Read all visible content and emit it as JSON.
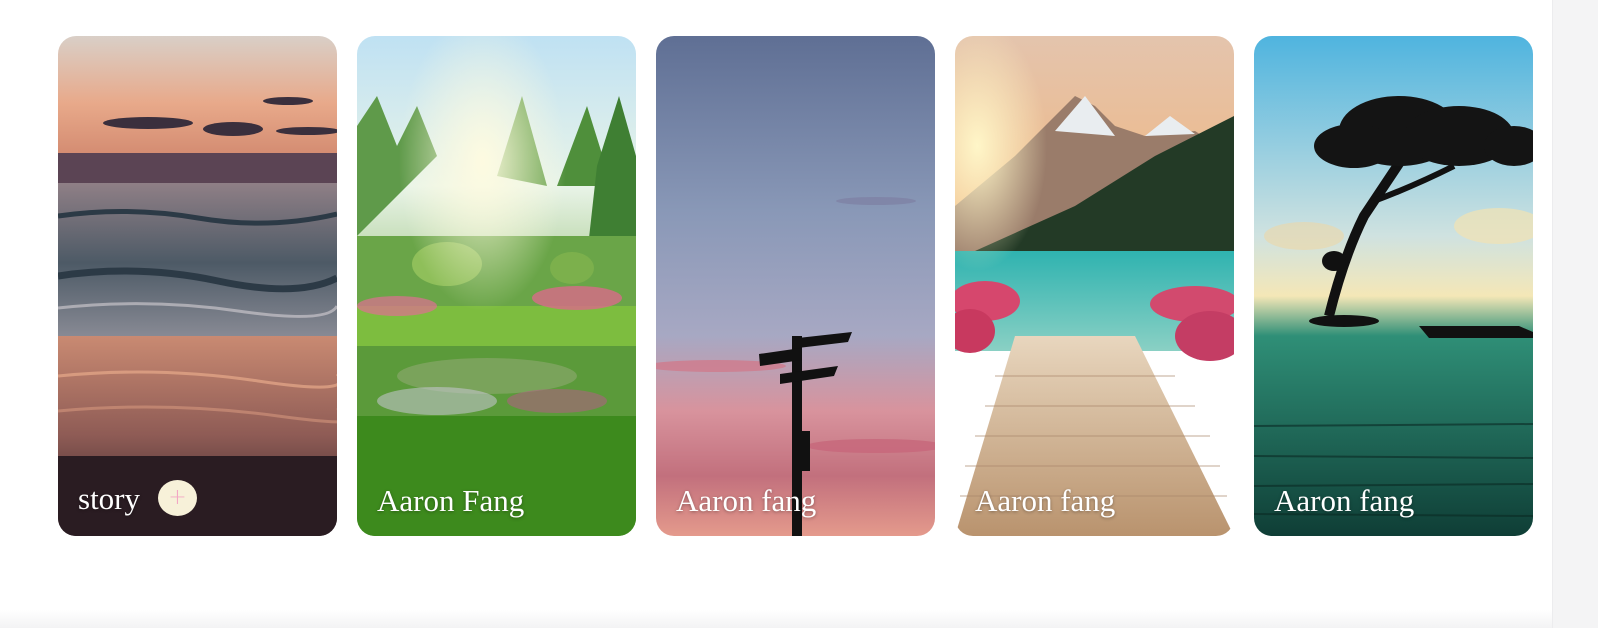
{
  "stories": {
    "create_card": {
      "label": "story",
      "add_icon": "plus-icon",
      "add_symbol": "+"
    },
    "cards": [
      {
        "author": "Aaron Fang",
        "scene": "garden"
      },
      {
        "author": "Aaron fang",
        "scene": "signpost-sunset"
      },
      {
        "author": "Aaron fang",
        "scene": "lake-dock"
      },
      {
        "author": "Aaron fang",
        "scene": "lone-tree"
      }
    ]
  },
  "colors": {
    "add_button_bg": "#f7f1d9",
    "add_icon": "#f3a6c4",
    "label_text": "#ffffff"
  }
}
